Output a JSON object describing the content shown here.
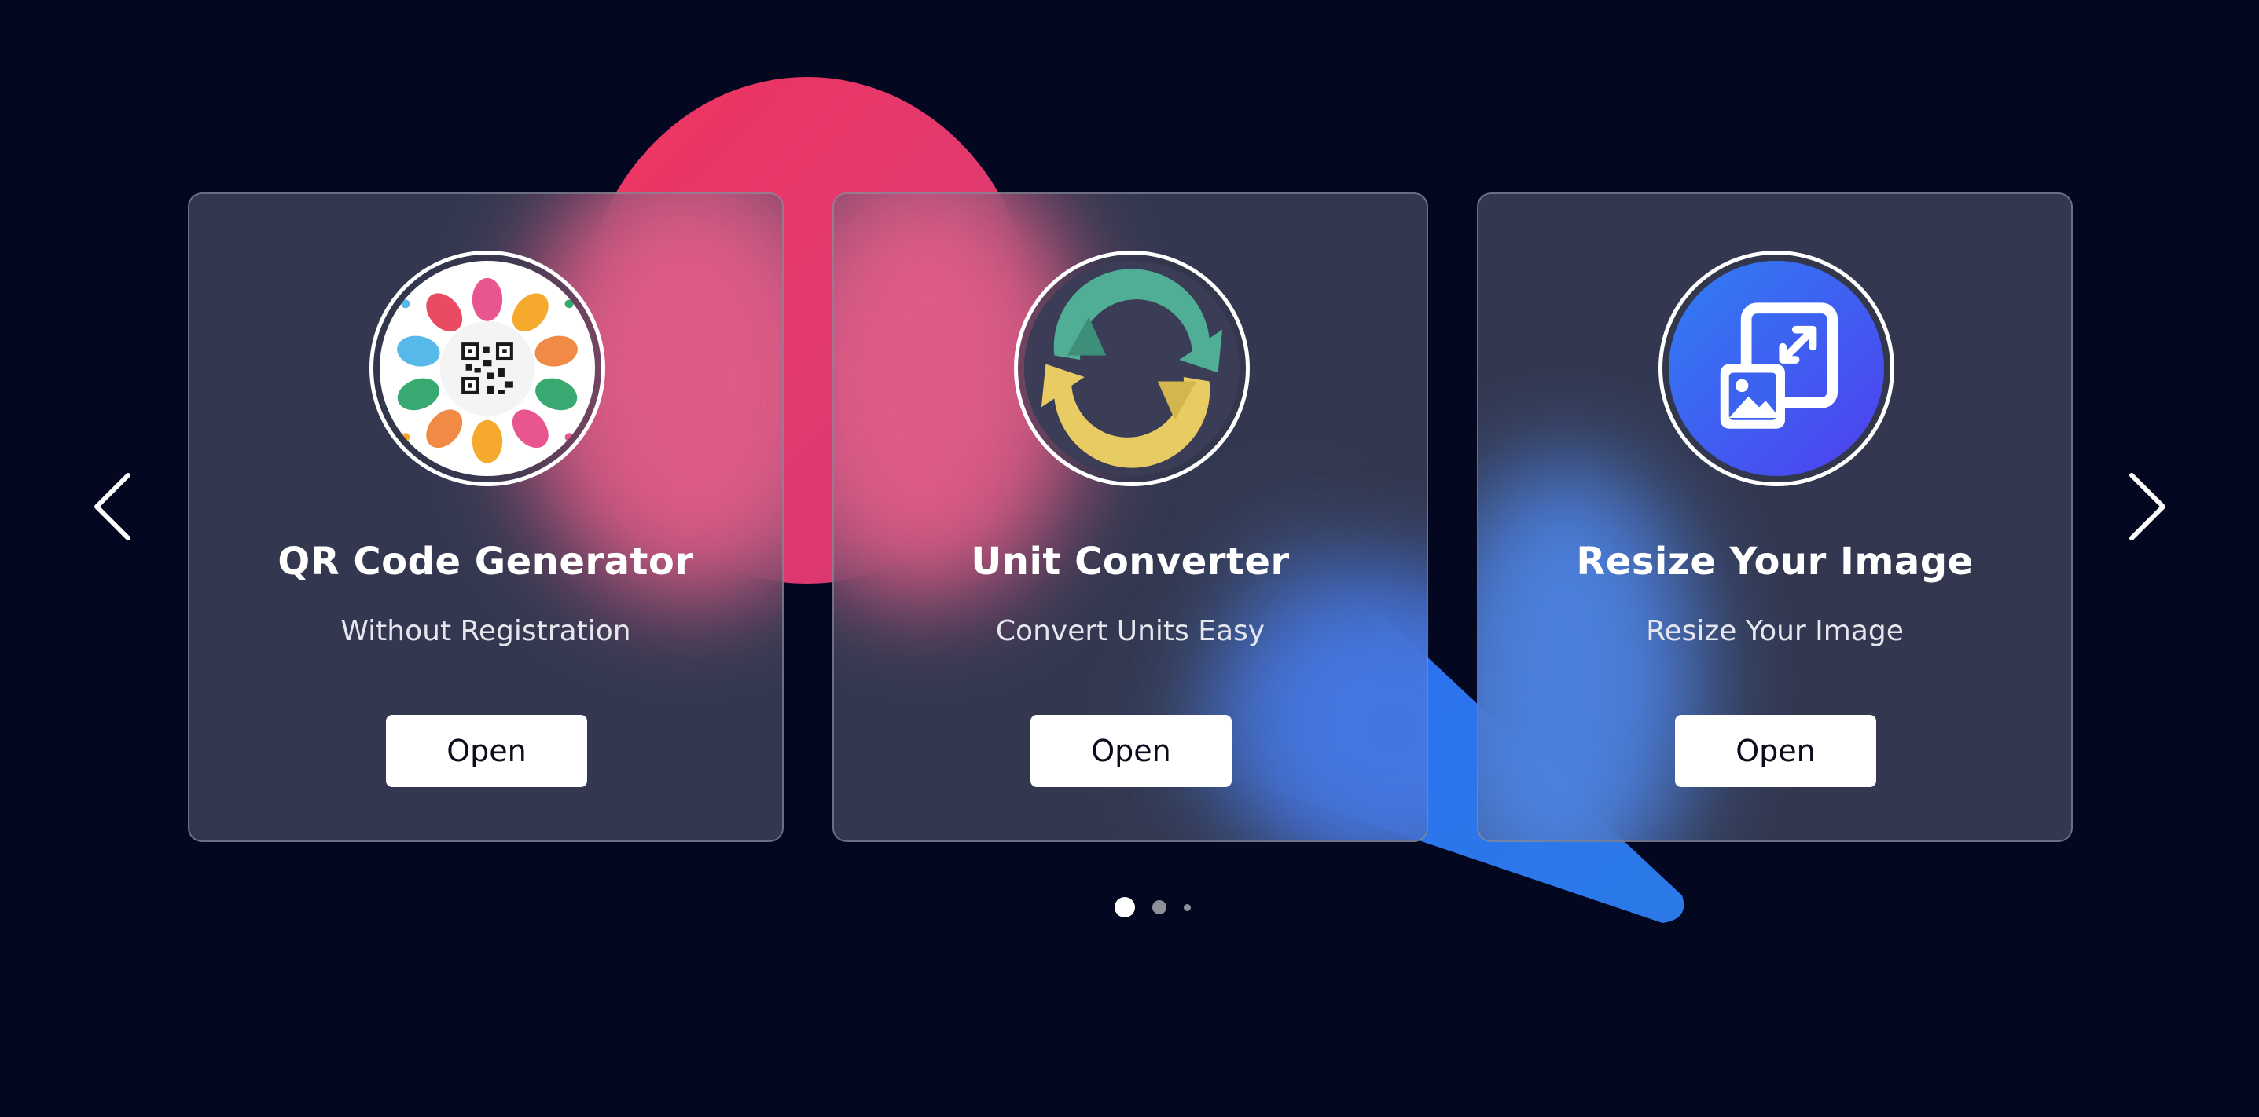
{
  "slider": {
    "cards": [
      {
        "title": "QR Code Generator",
        "subtitle": "Without Registration",
        "button_label": "Open",
        "icon": "qr-code-icon"
      },
      {
        "title": "Unit Converter",
        "subtitle": "Convert Units Easy",
        "button_label": "Open",
        "icon": "converter-arrows-icon"
      },
      {
        "title": "Resize Your Image",
        "subtitle": "Resize Your Image",
        "button_label": "Open",
        "icon": "resize-image-icon"
      }
    ],
    "nav": {
      "prev_icon": "chevron-left-icon",
      "next_icon": "chevron-right-icon"
    },
    "pagination": {
      "total": 3,
      "active": 1
    }
  },
  "colors": {
    "background": "#03071f",
    "accent_pink": "#e6375f",
    "accent_blue": "#2f6ff0",
    "card_button": "#ffffff"
  }
}
